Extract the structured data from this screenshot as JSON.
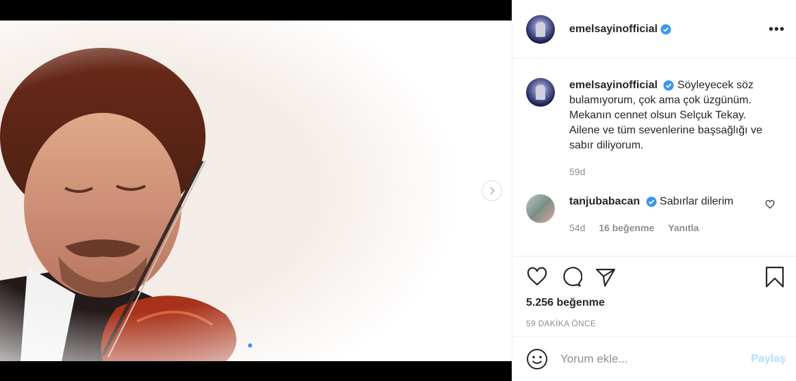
{
  "post": {
    "username": "emelsayinofficial",
    "verified": true,
    "more_icon": "more-horizontal-icon",
    "caption": "Söyleyecek söz bulamıyorum, çok ama çok üzgünüm. Mekanın cennet olsun Selçuk Tekay. Ailene ve tüm sevenlerine başsağlığı ve sabır diliyorum.",
    "caption_age": "59d",
    "likes": "5.256 beğenme",
    "posted": "59 DAKİKA ÖNCE",
    "carousel": {
      "current": 1,
      "total": 2
    }
  },
  "comments": [
    {
      "username": "tanjubabacan",
      "verified": true,
      "text": "Sabırlar dilerim",
      "age": "54d",
      "like_count": "16 beğenme",
      "reply_label": "Yanıtla"
    }
  ],
  "composer": {
    "placeholder": "Yorum ekle...",
    "post_label": "Paylaş"
  },
  "colors": {
    "verified_blue": "#3897f0",
    "post_disabled": "#b2dffc",
    "muted": "#8e8e8e"
  }
}
